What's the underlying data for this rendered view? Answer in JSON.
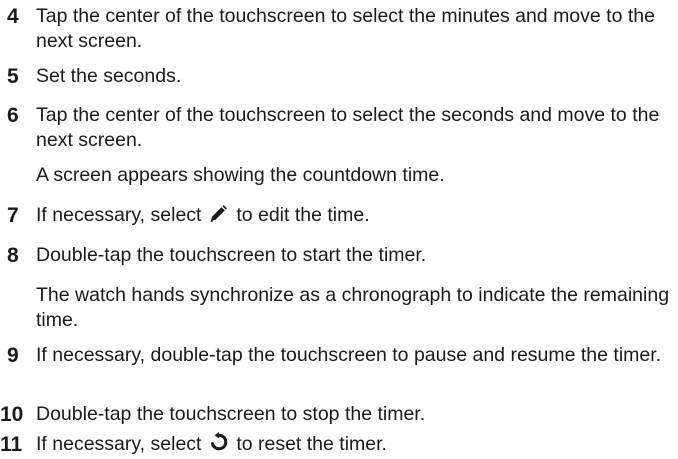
{
  "steps": [
    {
      "number": "4",
      "text": "Tap the center of the touchscreen to select the minutes and move to the next screen."
    },
    {
      "number": "5",
      "text": "Set the seconds."
    },
    {
      "number": "6",
      "text": "Tap the center of the touchscreen to select the seconds and move to the next screen."
    },
    {
      "note": "A screen appears showing the countdown time."
    },
    {
      "number": "7",
      "text_before": "If necessary, select",
      "icon": "pencil-icon",
      "text_after": "to edit the time."
    },
    {
      "number": "8",
      "text": "Double-tap the touchscreen to start the timer."
    },
    {
      "note": "The watch hands synchronize as a chronograph to indicate the remaining time."
    },
    {
      "number": "9",
      "text": "If necessary, double-tap the touchscreen to pause and resume the timer."
    },
    {
      "number": "10",
      "text": "Double-tap the touchscreen to stop the timer."
    },
    {
      "number": "11",
      "text_before": "If necessary, select",
      "icon": "reset-icon",
      "text_after": "to reset the timer."
    }
  ]
}
